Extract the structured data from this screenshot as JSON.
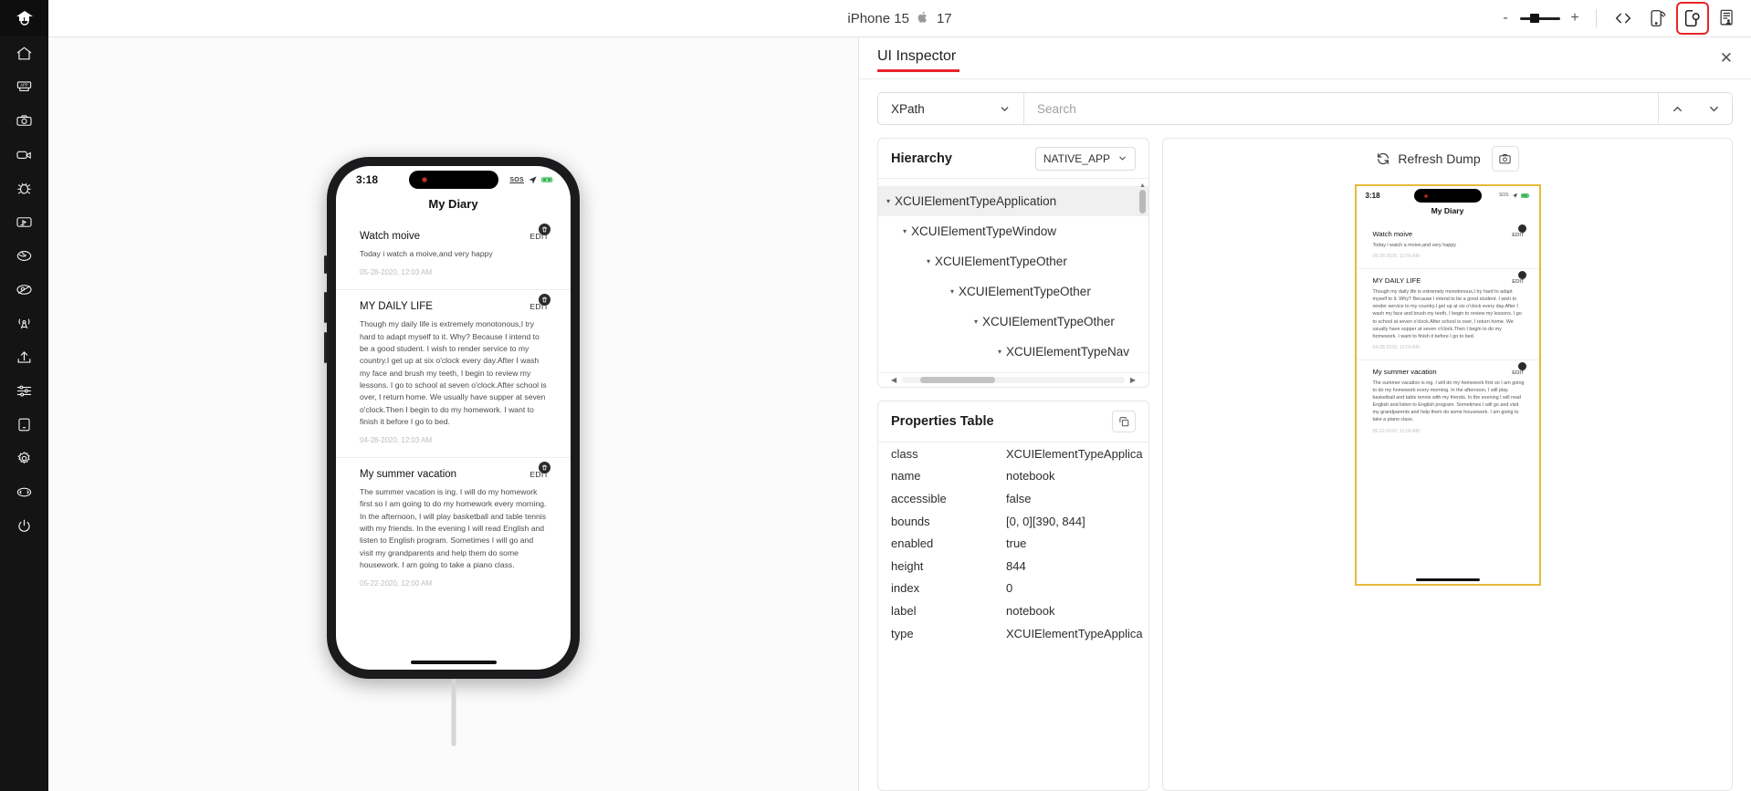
{
  "rail": {
    "logo_icon": "appium-logo-icon",
    "items": [
      {
        "icon": "home-icon",
        "name": "sidebar-item-home"
      },
      {
        "icon": "app-icon",
        "name": "sidebar-item-apps"
      },
      {
        "icon": "camera-icon",
        "name": "sidebar-item-screenshot"
      },
      {
        "icon": "video-icon",
        "name": "sidebar-item-recording"
      },
      {
        "icon": "bug-icon",
        "name": "sidebar-item-debug"
      },
      {
        "icon": "play-box-icon",
        "name": "sidebar-item-playback"
      },
      {
        "icon": "globe-icon",
        "name": "sidebar-item-network"
      },
      {
        "icon": "map-icon",
        "name": "sidebar-item-location"
      },
      {
        "icon": "broadcast-icon",
        "name": "sidebar-item-broadcast"
      },
      {
        "icon": "upload-icon",
        "name": "sidebar-item-upload"
      },
      {
        "icon": "sliders-icon",
        "name": "sidebar-item-settings-adjust"
      },
      {
        "icon": "device-icon",
        "name": "sidebar-item-device"
      },
      {
        "icon": "gear-icon",
        "name": "sidebar-item-preferences"
      },
      {
        "icon": "sync-icon",
        "name": "sidebar-item-sync"
      },
      {
        "icon": "power-icon",
        "name": "sidebar-item-power"
      }
    ]
  },
  "topbar": {
    "device_name": "iPhone 15",
    "apple_glyph": "",
    "os_version": "17",
    "zoom_out_label": "-",
    "zoom_in_label": "+",
    "icons": [
      {
        "icon": "code-icon",
        "name": "toolbar-code-button",
        "active": false
      },
      {
        "icon": "device-stream-icon",
        "name": "toolbar-device-stream-button",
        "active": false
      },
      {
        "icon": "ui-inspector-icon",
        "name": "toolbar-ui-inspector-button",
        "active": true
      },
      {
        "icon": "report-icon",
        "name": "toolbar-report-button",
        "active": false
      }
    ]
  },
  "phone": {
    "status": {
      "clock": "3:18",
      "sos": "SOS"
    },
    "app_title": "My Diary",
    "entries": [
      {
        "title": "Watch moive",
        "edit_label": "EDIT",
        "body": "Today i watch a moive,and very happy",
        "date": "05-28-2020, 12:03 AM"
      },
      {
        "title": "MY DAILY LIFE",
        "edit_label": "EDIT",
        "body": "Though my daily life is extremely monotonous,I try hard to adapt myself to it. Why? Because I intend to be a good student. I wish to render service to my country.I get up at six o'clock every day.After I wash my face and brush my teeth, I begin to review my lessons. I go to school at seven o'clock.After school is over, I return home. We usually have supper at seven o'clock.Then I begin to do my homework. I want to finish it before I go to bed.",
        "date": "04-28-2020, 12:03 AM"
      },
      {
        "title": "My summer vacation",
        "edit_label": "EDIT",
        "body": "The summer vacation is ing. I will do my homework first so I am going to do my homework every morning. In the afternoon, I will play basketball and table tennis with my friends. In the evening I will read English and listen to English program. Sometimes I will go and visit my grandparents and help them do some housework. I am going to take a piano class.",
        "date": "05-22-2020, 12:00 AM"
      }
    ]
  },
  "inspector": {
    "title": "UI Inspector",
    "close_label": "✕",
    "search": {
      "selector_type": "XPath",
      "placeholder": "Search",
      "value": "",
      "prev_icon": "chevron-up-icon",
      "next_icon": "chevron-down-icon"
    },
    "hierarchy": {
      "title": "Hierarchy",
      "context": "NATIVE_APP",
      "nodes": [
        {
          "label": "XCUIElementTypeApplication",
          "depth": 0,
          "selected": true
        },
        {
          "label": "XCUIElementTypeWindow",
          "depth": 1,
          "selected": false
        },
        {
          "label": "XCUIElementTypeOther",
          "depth": 2,
          "selected": false
        },
        {
          "label": "XCUIElementTypeOther",
          "depth": 3,
          "selected": false
        },
        {
          "label": "XCUIElementTypeOther",
          "depth": 4,
          "selected": false
        },
        {
          "label": "XCUIElementTypeNav",
          "depth": 5,
          "selected": false
        }
      ]
    },
    "properties": {
      "title": "Properties Table",
      "copy_icon": "copy-icon",
      "rows": [
        {
          "key": "class",
          "value": "XCUIElementTypeApplica"
        },
        {
          "key": "name",
          "value": "notebook"
        },
        {
          "key": "accessible",
          "value": "false"
        },
        {
          "key": "bounds",
          "value": "[0, 0][390, 844]"
        },
        {
          "key": "enabled",
          "value": "true"
        },
        {
          "key": "height",
          "value": "844"
        },
        {
          "key": "index",
          "value": "0"
        },
        {
          "key": "label",
          "value": "notebook"
        },
        {
          "key": "type",
          "value": "XCUIElementTypeApplica"
        }
      ]
    },
    "preview": {
      "refresh_label": "Refresh Dump",
      "refresh_icon": "refresh-icon",
      "snapshot_icon": "snapshot-icon",
      "highlight_color": "#e8b93a"
    }
  },
  "colors": {
    "accent_red": "#e8252a",
    "rail_bg": "#141414",
    "highlight": "#e8b93a"
  }
}
